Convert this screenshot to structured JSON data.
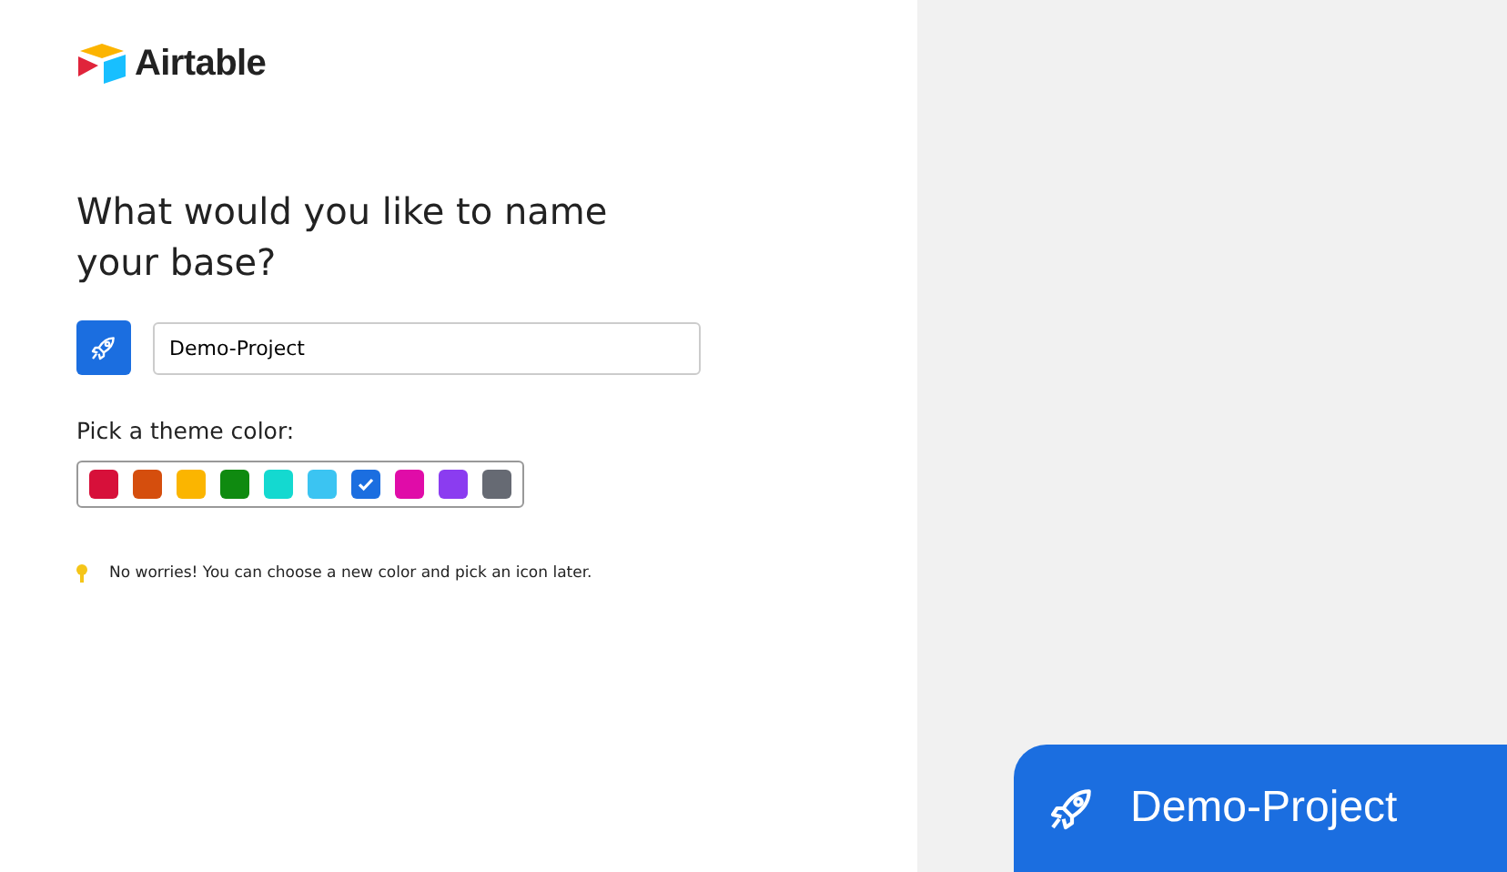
{
  "logo": {
    "name": "Airtable"
  },
  "heading": "What would you like to name your base?",
  "name_field": {
    "value": "Demo-Project"
  },
  "theme_label": "Pick a theme color:",
  "colors": [
    {
      "color": "#d7103a",
      "selected": false
    },
    {
      "color": "#d54e0d",
      "selected": false
    },
    {
      "color": "#fbb500",
      "selected": false
    },
    {
      "color": "#0f8a10",
      "selected": false
    },
    {
      "color": "#14d9d0",
      "selected": false
    },
    {
      "color": "#3bc4f2",
      "selected": false
    },
    {
      "color": "#1b6ee0",
      "selected": true
    },
    {
      "color": "#e00ca8",
      "selected": false
    },
    {
      "color": "#8b3cf0",
      "selected": false
    },
    {
      "color": "#666a73",
      "selected": false
    }
  ],
  "hint": "No worries! You can choose a new color and pick an icon later.",
  "preview": {
    "title": "Demo-Project"
  }
}
